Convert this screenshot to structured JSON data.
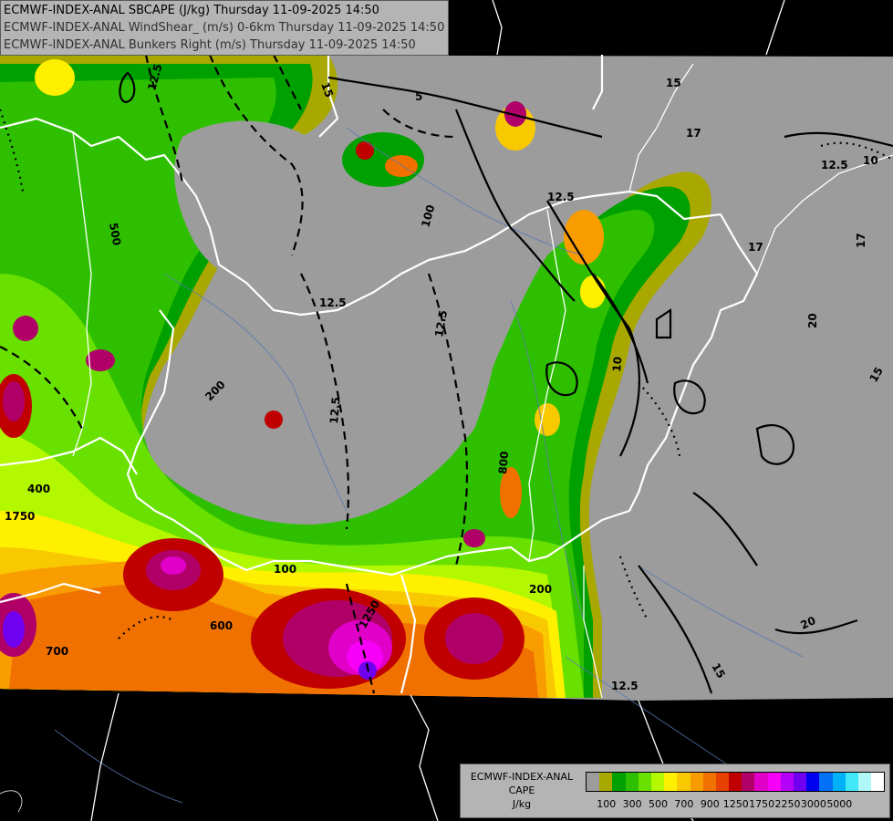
{
  "header": {
    "lines": [
      "ECMWF-INDEX-ANAL SBCAPE (J/kg) Thursday 11-09-2025 14:50",
      "ECMWF-INDEX-ANAL WindShear_ (m/s) 0-6km Thursday 11-09-2025 14:50",
      "ECMWF-INDEX-ANAL Bunkers Right (m/s) Thursday 11-09-2025 14:50"
    ]
  },
  "legend": {
    "model": "ECMWF-INDEX-ANAL",
    "parameter": "CAPE",
    "unit": "J/kg",
    "colors": [
      "#9c9c9c",
      "#a8a800",
      "#00a000",
      "#2ec000",
      "#68e000",
      "#b4f800",
      "#fff000",
      "#f8c800",
      "#f89c00",
      "#f07000",
      "#e84000",
      "#c00000",
      "#b00068",
      "#e000c8",
      "#f800f8",
      "#b400f8",
      "#7000f0",
      "#0000f0",
      "#0070f8",
      "#00b0f8",
      "#40e8f8",
      "#b0f8f8",
      "#ffffff"
    ],
    "tick_labels": [
      "100",
      "300",
      "500",
      "700",
      "900",
      "1250",
      "1750",
      "2250",
      "3000",
      "5000"
    ]
  },
  "map_labels": [
    {
      "text": "12.5"
    },
    {
      "text": "15"
    },
    {
      "text": "17"
    },
    {
      "text": "20"
    },
    {
      "text": "10"
    },
    {
      "text": "100"
    },
    {
      "text": "200"
    },
    {
      "text": "400"
    },
    {
      "text": "600"
    },
    {
      "text": "700"
    },
    {
      "text": "1250"
    },
    {
      "text": "1750"
    },
    {
      "text": "12.5"
    },
    {
      "text": "12.5"
    },
    {
      "text": "15"
    },
    {
      "text": "12.5"
    },
    {
      "text": "17"
    },
    {
      "text": "20"
    },
    {
      "text": "12.5"
    },
    {
      "text": "10"
    },
    {
      "text": "15"
    },
    {
      "text": "17"
    },
    {
      "text": "12.5"
    },
    {
      "text": "5"
    },
    {
      "text": "100"
    },
    {
      "text": "200"
    },
    {
      "text": "500"
    },
    {
      "text": "800"
    },
    {
      "text": "15"
    },
    {
      "text": "12.5"
    }
  ]
}
